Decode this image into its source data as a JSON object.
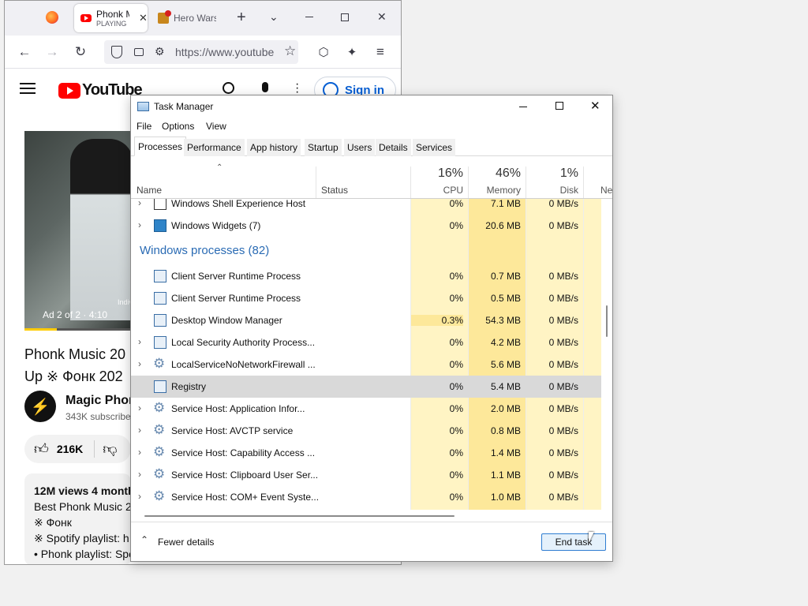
{
  "browser": {
    "tabs": [
      {
        "title": "Phonk M",
        "sub": "PLAYING"
      },
      {
        "title": "Hero Wars"
      }
    ],
    "url": "https://www.youtube"
  },
  "youtube": {
    "brand": "YouTube",
    "sign_in": "Sign in",
    "ad_label": "Ad 2 of 2 · 4:10",
    "overlay_text": "Indiv",
    "title_line1": "Phonk Music 20",
    "title_line2": "Up ※ Фонк 202",
    "channel": "Magic Phon",
    "subscribers": "343K subscribe",
    "likes": "216K",
    "views": "12M views  4 month",
    "desc1": "Best Phonk Music 2",
    "desc2": "※ Фонк",
    "desc3": "※ Spotify playlist: h",
    "desc4": "• Phonk playlist: Spotify"
  },
  "taskmanager": {
    "title": "Task Manager",
    "menus": [
      "File",
      "Options",
      "View"
    ],
    "tabs": [
      "Processes",
      "Performance",
      "App history",
      "Startup",
      "Users",
      "Details",
      "Services"
    ],
    "columns": {
      "name": "Name",
      "status": "Status",
      "cpu_pct": "16%",
      "cpu": "CPU",
      "mem_pct": "46%",
      "mem": "Memory",
      "disk_pct": "1%",
      "disk": "Disk",
      "net": "Net"
    },
    "group": "Windows processes (82)",
    "rows": [
      {
        "name": "Windows Shell Experience Host",
        "cpu": "0%",
        "mem": "7.1 MB",
        "disk": "0 MB/s"
      },
      {
        "name": "Windows Widgets (7)",
        "cpu": "0%",
        "mem": "20.6 MB",
        "disk": "0 MB/s"
      },
      {
        "name": "Client Server Runtime Process",
        "cpu": "0%",
        "mem": "0.7 MB",
        "disk": "0 MB/s"
      },
      {
        "name": "Client Server Runtime Process",
        "cpu": "0%",
        "mem": "0.5 MB",
        "disk": "0 MB/s"
      },
      {
        "name": "Desktop Window Manager",
        "cpu": "0.3%",
        "mem": "54.3 MB",
        "disk": "0 MB/s"
      },
      {
        "name": "Local Security Authority Process...",
        "cpu": "0%",
        "mem": "4.2 MB",
        "disk": "0 MB/s"
      },
      {
        "name": "LocalServiceNoNetworkFirewall ...",
        "cpu": "0%",
        "mem": "5.6 MB",
        "disk": "0 MB/s"
      },
      {
        "name": "Registry",
        "cpu": "0%",
        "mem": "5.4 MB",
        "disk": "0 MB/s"
      },
      {
        "name": "Service Host: Application Infor...",
        "cpu": "0%",
        "mem": "2.0 MB",
        "disk": "0 MB/s"
      },
      {
        "name": "Service Host: AVCTP service",
        "cpu": "0%",
        "mem": "0.8 MB",
        "disk": "0 MB/s"
      },
      {
        "name": "Service Host: Capability Access ...",
        "cpu": "0%",
        "mem": "1.4 MB",
        "disk": "0 MB/s"
      },
      {
        "name": "Service Host: Clipboard User Ser...",
        "cpu": "0%",
        "mem": "1.1 MB",
        "disk": "0 MB/s"
      },
      {
        "name": "Service Host: COM+ Event Syste...",
        "cpu": "0%",
        "mem": "1.0 MB",
        "disk": "0 MB/s"
      }
    ],
    "fewer_details": "Fewer details",
    "end_task": "End task"
  }
}
